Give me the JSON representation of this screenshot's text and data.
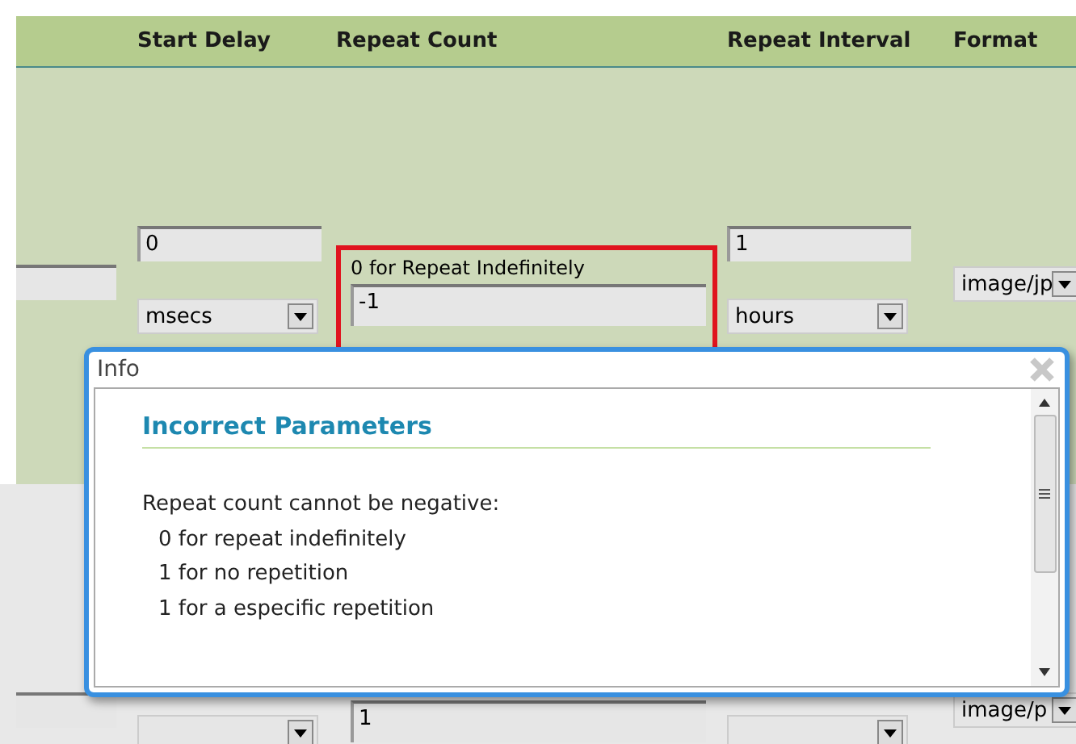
{
  "header": {
    "columns": [
      "Start Delay",
      "Repeat Count",
      "Repeat Interval",
      "Format"
    ]
  },
  "rows": [
    {
      "start_delay": "0",
      "start_delay_unit": "msecs",
      "repeat_count_hint": "0 for Repeat Indefinitely",
      "repeat_count": "-1",
      "repeat_count_error": true,
      "repeat_interval": "1",
      "repeat_interval_unit": "hours",
      "format": "image/jp"
    },
    {
      "repeat_count": "1",
      "repeat_count_error": false,
      "format": "image/p"
    }
  ],
  "dialog": {
    "title": "Info",
    "heading": "Incorrect Parameters",
    "lines": [
      {
        "kind": "intro",
        "text": "Repeat count cannot be negative:"
      },
      {
        "kind": "option",
        "text": "0 for repeat indefinitely"
      },
      {
        "kind": "option",
        "text": "1 for no repetition"
      },
      {
        "kind": "option",
        "text": "1 for a especific repetition"
      }
    ]
  }
}
